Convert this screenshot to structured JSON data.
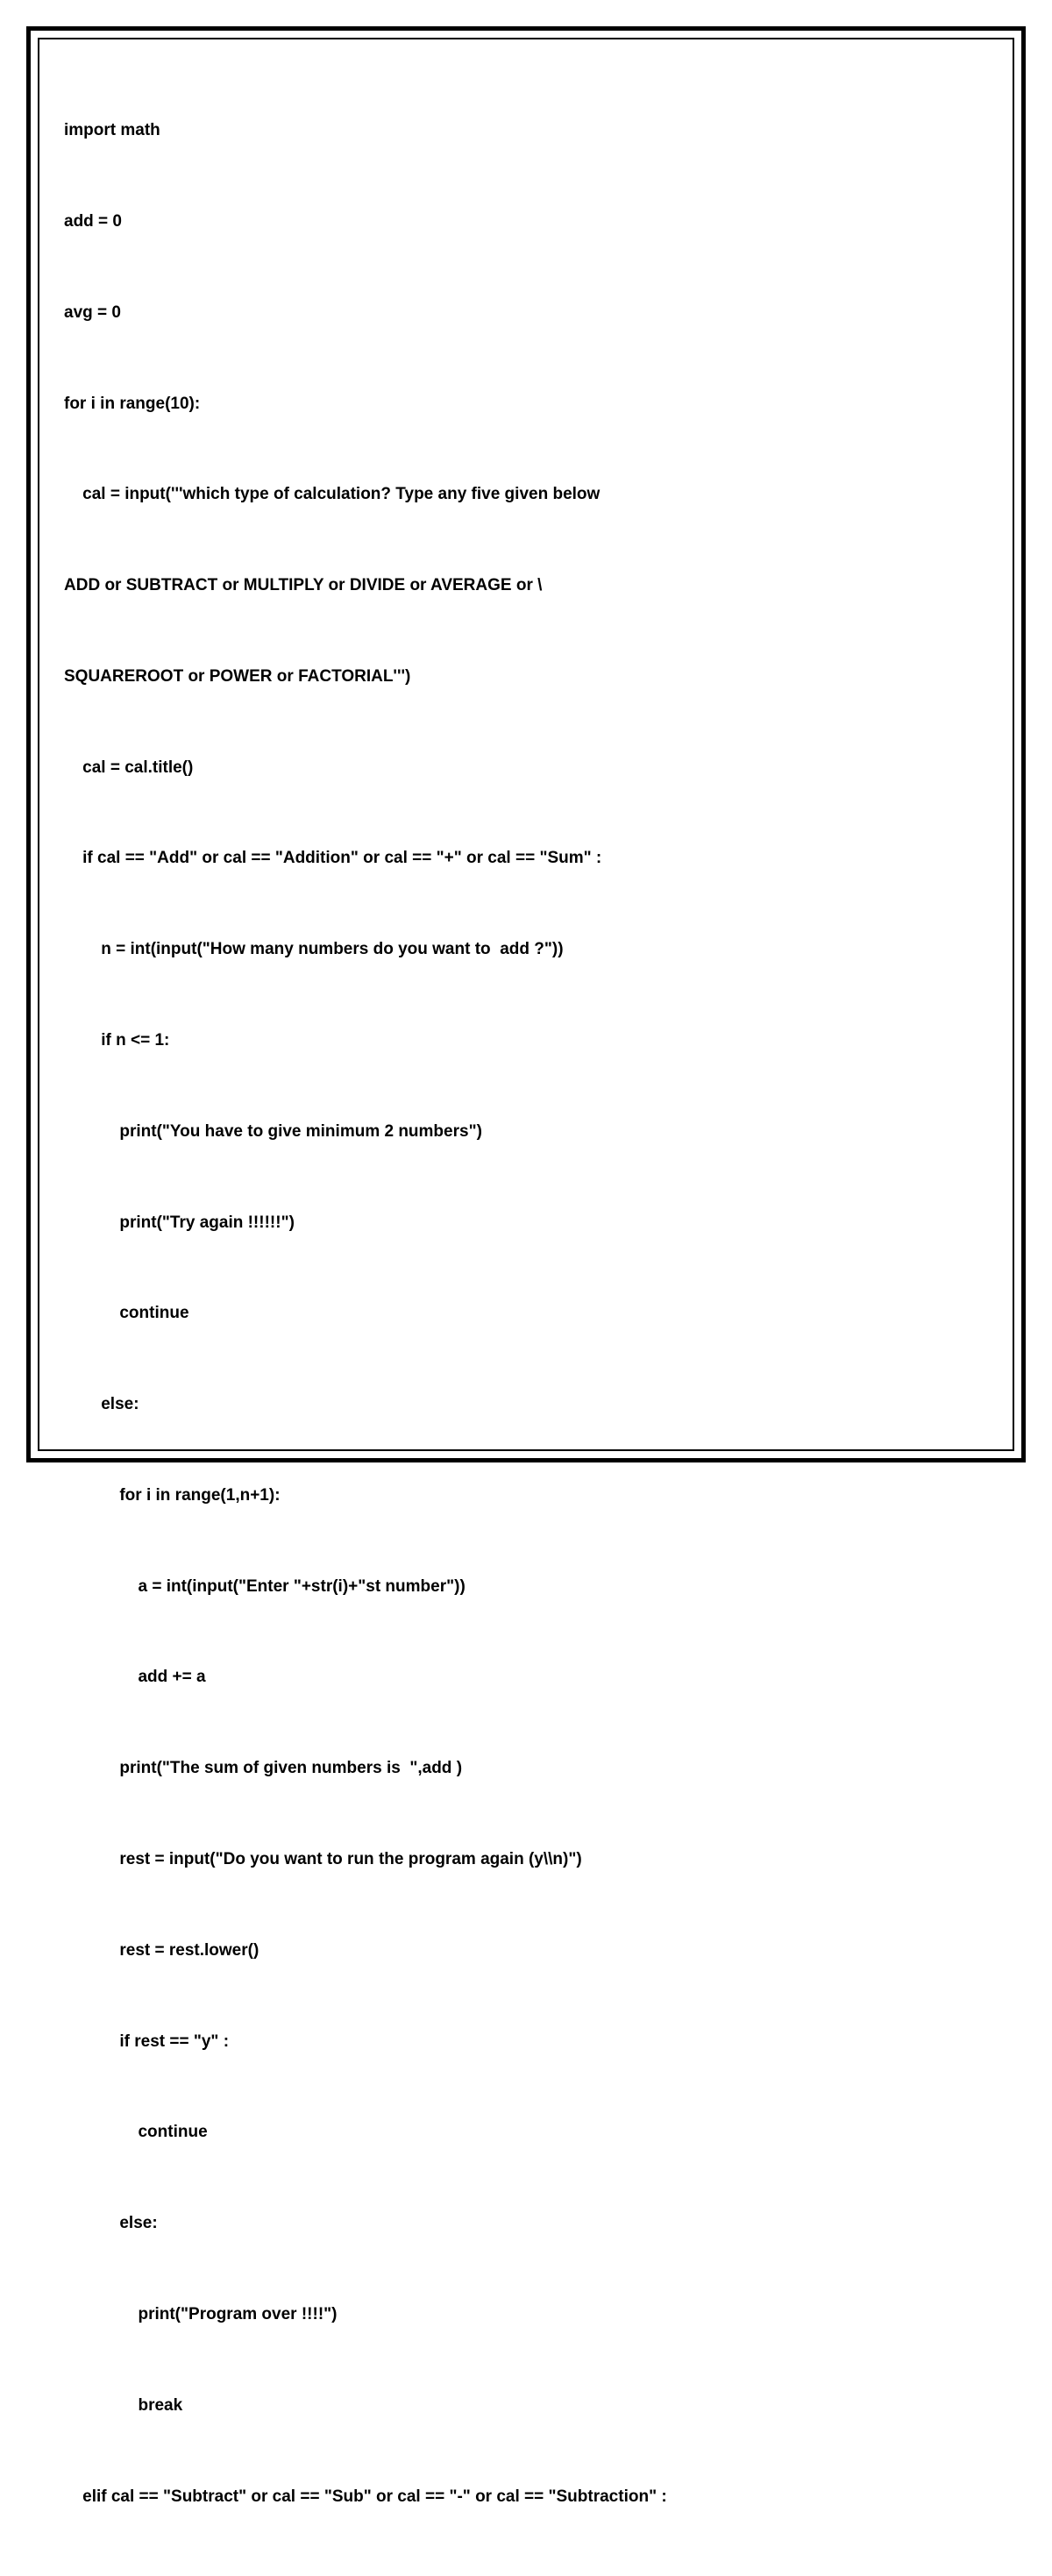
{
  "code": {
    "lines": [
      "import math",
      "add = 0",
      "avg = 0",
      "for i in range(10):",
      "    cal = input('''which type of calculation? Type any five given below",
      "ADD or SUBTRACT or MULTIPLY or DIVIDE or AVERAGE or \\",
      "SQUAREROOT or POWER or FACTORIAL''')",
      "    cal = cal.title()",
      "    if cal == \"Add\" or cal == \"Addition\" or cal == \"+\" or cal == \"Sum\" :",
      "        n = int(input(\"How many numbers do you want to  add ?\"))",
      "        if n <= 1:",
      "            print(\"You have to give minimum 2 numbers\")",
      "            print(\"Try again !!!!!!\")",
      "            continue",
      "        else:",
      "            for i in range(1,n+1):",
      "                a = int(input(\"Enter \"+str(i)+\"st number\"))",
      "                add += a",
      "            print(\"The sum of given numbers is  \",add )",
      "            rest = input(\"Do you want to run the program again (y\\\\n)\")",
      "            rest = rest.lower()",
      "            if rest == \"y\" :",
      "                continue",
      "            else:",
      "                print(\"Program over !!!!\")",
      "                break",
      "    elif cal == \"Subtract\" or cal == \"Sub\" or cal == \"-\" or cal == \"Subtraction\" :"
    ]
  }
}
